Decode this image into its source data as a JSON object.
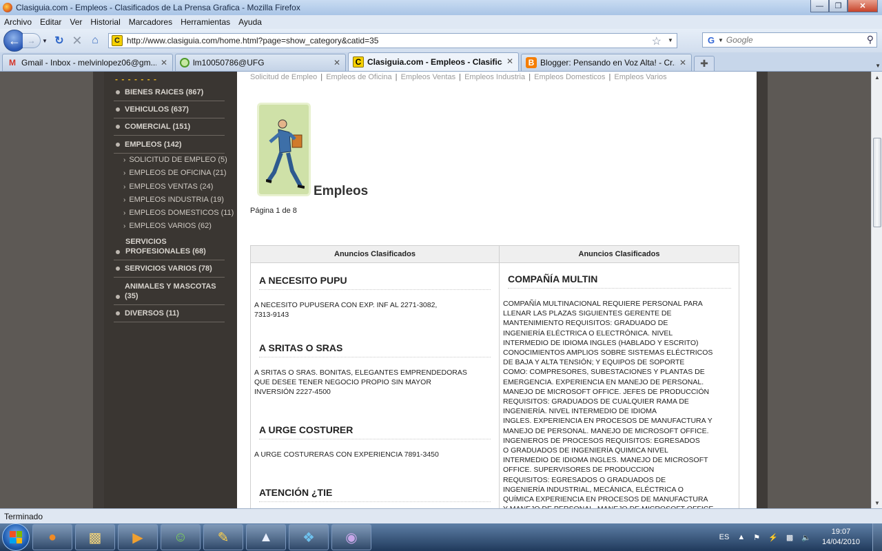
{
  "window": {
    "title": "Clasiguia.com - Empleos - Clasificados de La Prensa Grafica - Mozilla Firefox",
    "buttons": {
      "minimize": "—",
      "maximize": "❐",
      "close": "✕"
    }
  },
  "menu": [
    "Archivo",
    "Editar",
    "Ver",
    "Historial",
    "Marcadores",
    "Herramientas",
    "Ayuda"
  ],
  "nav": {
    "url": "http://www.clasiguia.com/home.html?page=show_category&catid=35",
    "search_placeholder": "Google"
  },
  "tabs": [
    {
      "label": "Gmail - Inbox - melvinlopez06@gm...",
      "icon": "gmail-icon",
      "active": false
    },
    {
      "label": "lm10050786@UFG",
      "icon": "ufg-icon",
      "active": false
    },
    {
      "label": "Clasiguia.com - Empleos - Clasifica...",
      "icon": "clasiguia-icon",
      "active": true
    },
    {
      "label": "Blogger: Pensando en Voz Alta! - Cr...",
      "icon": "blogger-icon",
      "active": false
    }
  ],
  "sidebar": {
    "dashes": "- - - - - - -",
    "categories": [
      {
        "label": "BIENES RAICES (867)"
      },
      {
        "label": "VEHICULOS (637)"
      },
      {
        "label": "COMERCIAL (151)"
      },
      {
        "label": "EMPLEOS (142)"
      },
      {
        "label": "SERVICIOS PROFESIONALES (68)"
      },
      {
        "label": "SERVICIOS VARIOS (78)"
      },
      {
        "label": "ANIMALES Y MASCOTAS (35)"
      },
      {
        "label": "DIVERSOS (11)"
      }
    ],
    "subcategories": [
      "SOLICITUD DE EMPLEO (5)",
      "EMPLEOS DE OFICINA (21)",
      "EMPLEOS VENTAS (24)",
      "EMPLEOS INDUSTRIA (19)",
      "EMPLEOS DOMESTICOS (11)",
      "EMPLEOS VARIOS (62)"
    ]
  },
  "main": {
    "subnav": [
      "Solicitud de Empleo",
      "Empleos de Oficina",
      "Empleos Ventas",
      "Empleos Industria",
      "Empleos Domesticos",
      "Empleos Varios"
    ],
    "subnav_sep": "|",
    "heading": "Empleos",
    "page_count": "Página 1 de 8",
    "column_headers": [
      "Anuncios Clasificados",
      "Anuncios Clasificados"
    ],
    "left_ads": [
      {
        "title": "A NECESITO PUPU",
        "text": "A NECESITO PUPUSERA CON EXP. INF AL 2271-3082,\n7313-9143"
      },
      {
        "title": "A SRITAS O SRAS",
        "text": "A SRITAS O SRAS. BONITAS, ELEGANTES EMPRENDEDORAS\nQUE DESEE TENER NEGOCIO PROPIO SIN MAYOR\nINVERSIÓN 2227-4500"
      },
      {
        "title": "A URGE COSTURER",
        "text": "A URGE COSTURERAS CON EXPERIENCIA 7891-3450"
      },
      {
        "title": "ATENCIÓN ¿TIE",
        "text": ""
      }
    ],
    "right_ads": [
      {
        "title": "COMPAÑÍA MULTIN",
        "text": "COMPAÑÍA MULTINACIONAL REQUIERE PERSONAL PARA\nLLENAR LAS PLAZAS SIGUIENTES GERENTE DE\nMANTENIMIENTO REQUISITOS: GRADUADO DE\nINGENIERÍA ELÉCTRICA O ELECTRÓNICA. NIVEL\nINTERMEDIO DE IDIOMA INGLES (HABLADO Y ESCRITO)\nCONOCIMIENTOS AMPLIOS SOBRE SISTEMAS ELÉCTRICOS\nDE BAJA Y ALTA TENSIÓN; Y EQUIPOS DE SOPORTE\nCOMO: COMPRESORES, SUBESTACIONES Y PLANTAS DE\nEMERGENCIA. EXPERIENCIA EN MANEJO DE PERSONAL.\nMANEJO DE MICROSOFT OFFICE. JEFES DE PRODUCCIÓN\nREQUISITOS: GRADUADOS DE CUALQUIER RAMA DE\nINGENIERÍA. NIVEL INTERMEDIO DE IDIOMA\nINGLES. EXPERIENCIA EN PROCESOS DE MANUFACTURA Y\nMANEJO DE PERSONAL. MANEJO DE MICROSOFT OFFICE.\nINGENIEROS DE PROCESOS REQUISITOS: EGRESADOS\nO GRADUADOS DE INGENIERÍA QUIMICA NIVEL\nINTERMEDIO DE IDIOMA INGLES. MANEJO DE MICROSOFT\nOFFICE. SUPERVISORES DE PRODUCCION\nREQUISITOS: EGRESADOS O GRADUADOS DE\nINGENIERÍA INDUSTRIAL, MECÁNICA, ELÉCTRICA O\nQUÍMICA EXPERIENCIA EN PROCESOS DE MANUFACTURA\nY MANEJO DE PERSONAL. MANEJO DE MICROSOFT OFFICE"
      }
    ]
  },
  "status": "Terminado",
  "taskbar": {
    "lang": "ES",
    "time": "19:07",
    "date": "14/04/2010"
  },
  "colors": {
    "page_bg": "#5d5955",
    "sidebar_bg": "#3a3632",
    "accent_dashes": "#e6b422",
    "hero_bg": "#cfe1a8"
  }
}
